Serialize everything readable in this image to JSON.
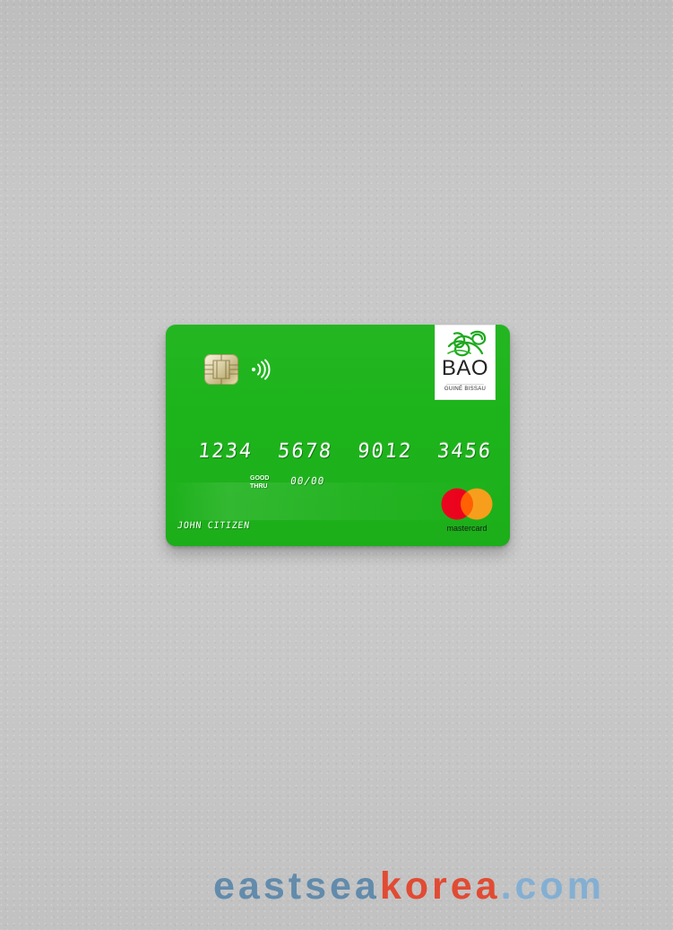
{
  "card": {
    "bank": {
      "name": "BAO",
      "country": "GUINÉ BISSAU"
    },
    "number_groups": [
      "1234",
      "5678",
      "9012",
      "3456"
    ],
    "good_thru_label": "GOOD\nTHRU",
    "expiry": "00/00",
    "cardholder": "JOHN CITIZEN",
    "network": {
      "wordmark": "mastercard"
    },
    "icons": {
      "chip": "chip-icon",
      "contactless": "contactless-icon",
      "bank_logo": "bank-logo-icon",
      "network_logo": "mastercard-logo"
    },
    "colors": {
      "card_green": "#1db41b",
      "logo_green": "#1ea91f",
      "mastercard_red": "#eb001b",
      "mastercard_orange": "#f79e1b",
      "mastercard_overlap": "#ff5f00"
    }
  },
  "watermark": {
    "part_1": "eastsea",
    "part_2": "korea",
    "part_3": ".com"
  }
}
